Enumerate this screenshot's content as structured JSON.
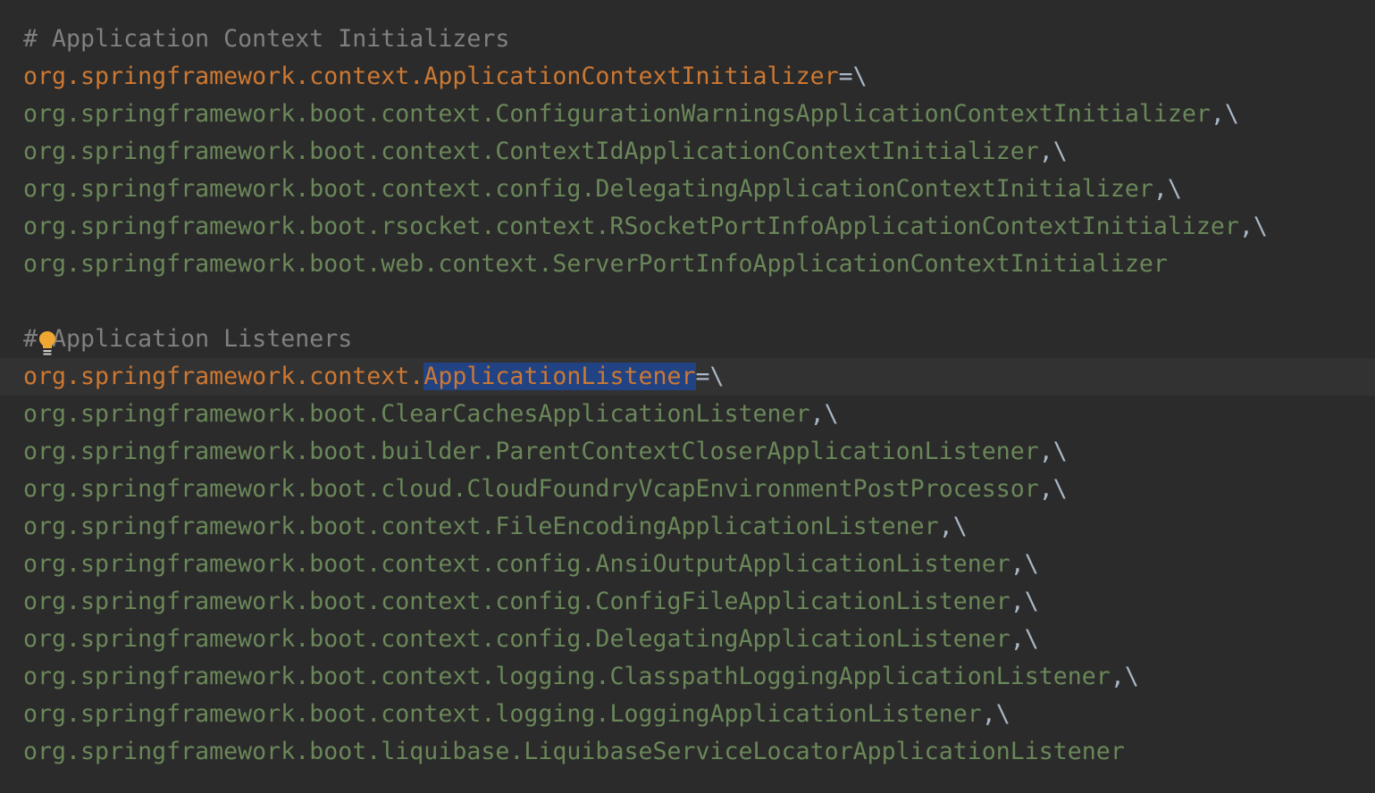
{
  "colors": {
    "background": "#2b2b2b",
    "caret_line": "#323232",
    "comment": "#808080",
    "key": "#cc7832",
    "value": "#6a8759",
    "operator": "#a9b7c6",
    "selection": "#214283",
    "bulb": "#f0a732"
  },
  "lines": [
    {
      "comment": "# Application Context Initializers"
    },
    {
      "key": "org.springframework.context.ApplicationContextInitializer",
      "op": "=\\"
    },
    {
      "value": "org.springframework.boot.context.ConfigurationWarningsApplicationContextInitializer",
      "op": ",\\"
    },
    {
      "value": "org.springframework.boot.context.ContextIdApplicationContextInitializer",
      "op": ",\\"
    },
    {
      "value": "org.springframework.boot.context.config.DelegatingApplicationContextInitializer",
      "op": ",\\"
    },
    {
      "value": "org.springframework.boot.rsocket.context.RSocketPortInfoApplicationContextInitializer",
      "op": ",\\"
    },
    {
      "value": "org.springframework.boot.web.context.ServerPortInfoApplicationContextInitializer",
      "op": ""
    },
    {
      "blank": ""
    },
    {
      "comment_hash": "#",
      "comment_rest": "Application Listeners"
    },
    {
      "key_prefix": "org.springframework.context.",
      "key_selected": "ApplicationListener",
      "op": "=\\"
    },
    {
      "value": "org.springframework.boot.ClearCachesApplicationListener",
      "op": ",\\"
    },
    {
      "value": "org.springframework.boot.builder.ParentContextCloserApplicationListener",
      "op": ",\\"
    },
    {
      "value": "org.springframework.boot.cloud.CloudFoundryVcapEnvironmentPostProcessor",
      "op": ",\\"
    },
    {
      "value": "org.springframework.boot.context.FileEncodingApplicationListener",
      "op": ",\\"
    },
    {
      "value": "org.springframework.boot.context.config.AnsiOutputApplicationListener",
      "op": ",\\"
    },
    {
      "value": "org.springframework.boot.context.config.ConfigFileApplicationListener",
      "op": ",\\"
    },
    {
      "value": "org.springframework.boot.context.config.DelegatingApplicationListener",
      "op": ",\\"
    },
    {
      "value": "org.springframework.boot.context.logging.ClasspathLoggingApplicationListener",
      "op": ",\\"
    },
    {
      "value": "org.springframework.boot.context.logging.LoggingApplicationListener",
      "op": ",\\"
    },
    {
      "value": "org.springframework.boot.liquibase.LiquibaseServiceLocatorApplicationListener",
      "op": ""
    }
  ],
  "intention_icon": "lightbulb-icon"
}
